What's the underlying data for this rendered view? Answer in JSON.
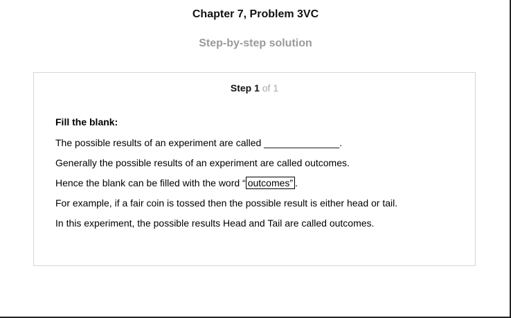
{
  "header": {
    "chapter_title": "Chapter 7, Problem 3VC",
    "subtitle": "Step-by-step solution"
  },
  "step": {
    "label": "Step 1",
    "of_text": "of 1"
  },
  "content": {
    "heading": "Fill the blank:",
    "question": "The possible results of an experiment are called ______________.",
    "line1": "Generally the possible results of an experiment are called outcomes.",
    "line2_prefix": "Hence the blank can be filled with the word “",
    "line2_answer": "outcomes”",
    "line2_suffix": ".",
    "line3": "For example, if a fair coin is tossed then the possible result is either head or tail.",
    "line4": "In this experiment, the possible results Head and Tail are called outcomes."
  }
}
